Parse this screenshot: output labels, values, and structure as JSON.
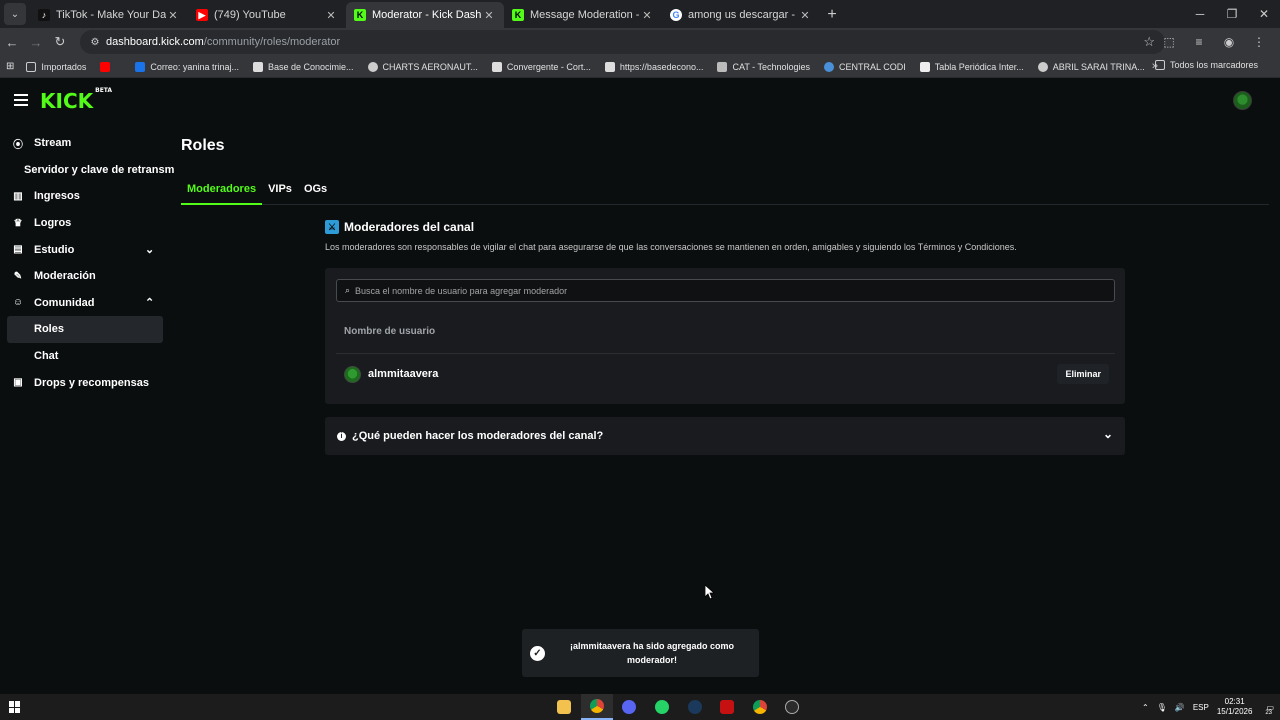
{
  "browser": {
    "tabs": [
      {
        "title": "TikTok - Make Your Day",
        "icon": "tiktok-icon",
        "color": "#000000"
      },
      {
        "title": "(749) YouTube",
        "icon": "youtube-icon",
        "color": "#ff0000"
      },
      {
        "title": "Moderator - Kick Dashboard",
        "icon": "kick-icon",
        "color": "#53fc18"
      },
      {
        "title": "Message Moderation - Kick Da",
        "icon": "kick-icon",
        "color": "#53fc18"
      },
      {
        "title": "among us descargar - Buscar c",
        "icon": "google-icon",
        "color": "#ffffff"
      }
    ],
    "url_host": "dashboard.kick.com",
    "url_path": "/community/roles/moderator",
    "bookmarks": [
      "Importados",
      "Correo: yanina trinaj...",
      "Base de Conocimie...",
      "CHARTS AERONAUT...",
      "Convergente - Cort...",
      "https://basedecono...",
      "CAT - Technologies",
      "CENTRAL CODI",
      "Tabla Periódica Inter...",
      "ABRIL SARAI TRINA..."
    ],
    "bookmarks_right": "Todos los marcadores"
  },
  "kick": {
    "logo": "KICK",
    "logo_badge": "BETA",
    "accent": "#53fc18"
  },
  "sidebar": {
    "items": [
      {
        "label": "Stream",
        "icon": "broadcast-icon"
      },
      {
        "label": "Servidor y clave de retransm"
      },
      {
        "label": "Ingresos",
        "icon": "chart-icon"
      },
      {
        "label": "Logros",
        "icon": "trophy-icon"
      },
      {
        "label": "Estudio",
        "icon": "studio-icon"
      },
      {
        "label": "Moderación",
        "icon": "wrench-icon"
      },
      {
        "label": "Comunidad",
        "icon": "community-icon"
      },
      {
        "label": "Roles"
      },
      {
        "label": "Chat"
      },
      {
        "label": "Drops y recompensas",
        "icon": "gift-icon"
      }
    ]
  },
  "main": {
    "title": "Roles",
    "tabs": [
      "Moderadores",
      "VIPs",
      "OGs"
    ],
    "section_title": "Moderadores del canal",
    "section_desc": "Los moderadores son responsables de vigilar el chat para asegurarse de que las conversaciones se mantienen en orden, amigables y siguiendo los Términos y Condiciones.",
    "search_placeholder": "Busca el nombre de usuario para agregar moderador",
    "column_header": "Nombre de usuario",
    "moderators": [
      {
        "username": "almmitaavera",
        "action": "Eliminar"
      }
    ],
    "faq": "¿Qué pueden hacer los moderadores del canal?"
  },
  "toast": {
    "message": "¡almmitaavera ha sido agregado como moderador!"
  },
  "taskbar": {
    "language": "ESP",
    "time": "02:31",
    "date": "15/1/2026",
    "notifications": "23"
  }
}
